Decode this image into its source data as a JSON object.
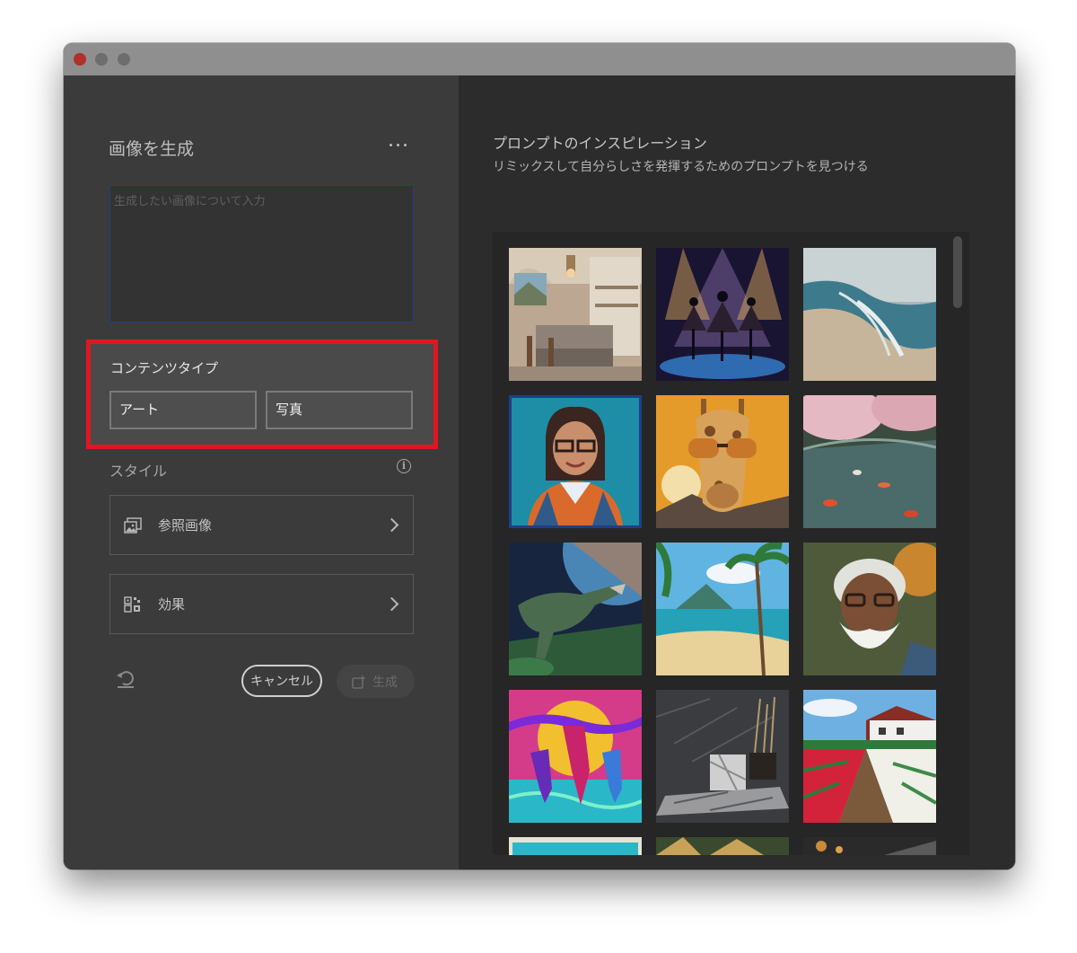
{
  "left_panel": {
    "title": "画像を生成",
    "prompt_placeholder": "生成したい画像について入力",
    "content_type": {
      "label": "コンテンツタイプ",
      "options": [
        "アート",
        "写真"
      ]
    },
    "style": {
      "label": "スタイル",
      "reference_image_label": "参照画像",
      "effects_label": "効果"
    },
    "actions": {
      "cancel_label": "キャンセル",
      "generate_label": "生成"
    }
  },
  "right_panel": {
    "title": "プロンプトのインスピレーション",
    "subtitle": "リミックスして自分らしさを発揮するためのプロンプトを見つける",
    "gallery": [
      {
        "name": "kitchen-interior"
      },
      {
        "name": "ballet-dancers-stage"
      },
      {
        "name": "misty-beach-waves"
      },
      {
        "name": "woman-portrait-glasses",
        "selected": true
      },
      {
        "name": "giraffe-sunglasses"
      },
      {
        "name": "cherry-blossom-koi-pond"
      },
      {
        "name": "dinosaur-space"
      },
      {
        "name": "tropical-beach"
      },
      {
        "name": "bearded-man-portrait"
      },
      {
        "name": "neon-horses-sunset"
      },
      {
        "name": "marble-still-life"
      },
      {
        "name": "tulip-field-farmhouse"
      },
      {
        "name": "partial-tropical-tile"
      },
      {
        "name": "partial-palm-tile"
      },
      {
        "name": "partial-dark-tile"
      }
    ]
  },
  "colors": {
    "highlight": "#e01623",
    "focus_border": "#1f3f86",
    "left_panel_bg": "#3b3b3b",
    "right_panel_bg": "#2c2c2c"
  }
}
